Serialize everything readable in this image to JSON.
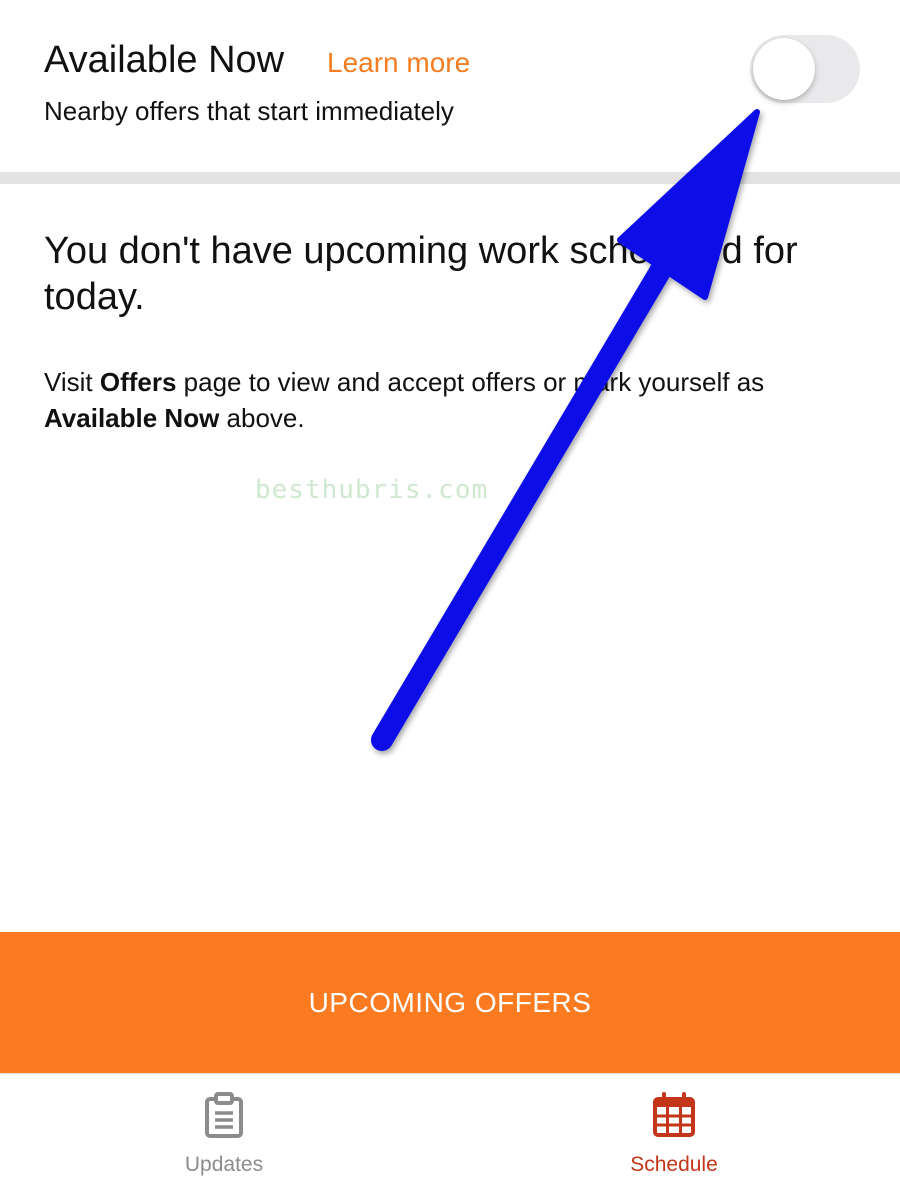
{
  "header": {
    "title": "Available Now",
    "learn_more": "Learn more",
    "subtitle": "Nearby offers that start immediately",
    "toggle_on": false
  },
  "empty_state": {
    "heading": "You don't have upcoming work scheduled for today.",
    "body_part1": "Visit ",
    "body_bold1": "Offers",
    "body_part2": " page to view and accept offers or mark yourself as ",
    "body_bold2": "Available Now",
    "body_part3": " above."
  },
  "watermark": "besthubris.com",
  "cta": {
    "label": "UPCOMING OFFERS"
  },
  "tabbar": {
    "tabs": [
      {
        "label": "Updates",
        "icon": "clipboard-icon",
        "active": false
      },
      {
        "label": "Schedule",
        "icon": "calendar-icon",
        "active": true
      }
    ]
  },
  "colors": {
    "accent": "#fd7b20",
    "link": "#f57c20",
    "active_tab": "#c4361a",
    "inactive_tab": "#8c8c8c",
    "annotation_arrow": "#0a10e8"
  }
}
